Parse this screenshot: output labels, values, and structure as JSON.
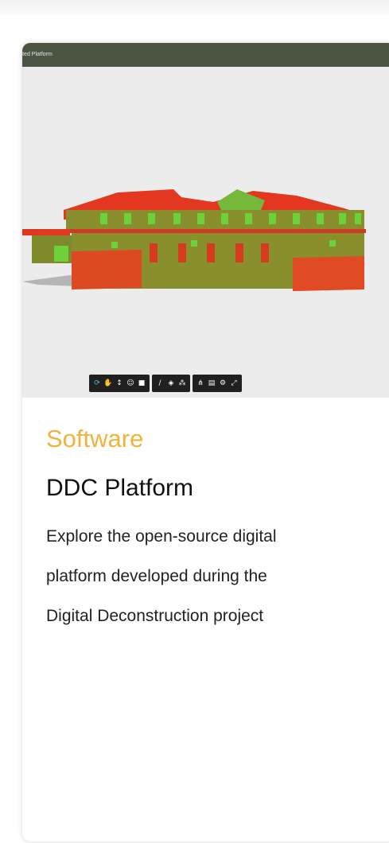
{
  "viewer": {
    "header_title": "grated Platform",
    "toolbar": {
      "groups": [
        [
          "orbit-icon",
          "pan-icon",
          "walk-icon",
          "person-icon",
          "camera-icon"
        ],
        [
          "measure-icon",
          "section-icon",
          "explode-icon"
        ],
        [
          "model-browser-icon",
          "properties-icon",
          "settings-icon",
          "fullscreen-icon"
        ]
      ],
      "active_tool": "orbit-icon"
    }
  },
  "card": {
    "category": "Software",
    "title": "DDC Platform",
    "description": "Explore the open-source digital platform developed during the Digital Deconstruction project"
  },
  "colors": {
    "category": "#f3b23b",
    "viewer_header": "#4b5541",
    "roof_red": "#e3381f",
    "wall_olive": "#8a8f2d",
    "window_green": "#6fd13a"
  }
}
